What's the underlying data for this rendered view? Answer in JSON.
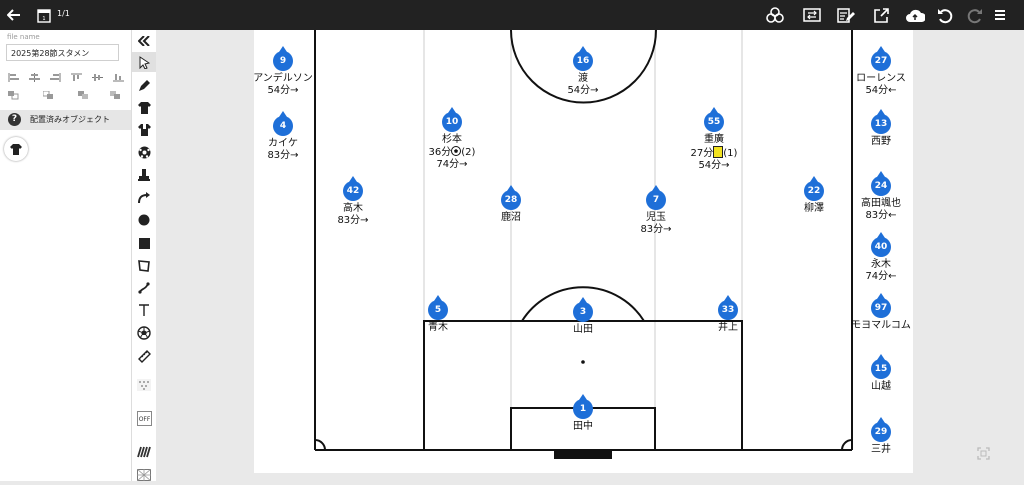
{
  "topbar": {
    "pager": "1/1",
    "icons": [
      "back-arrow-icon",
      "page-icon",
      "team-icon",
      "swap-icon",
      "edit-icon",
      "export-icon",
      "cloud-upload-icon",
      "undo-icon",
      "redo-icon",
      "menu-icon"
    ]
  },
  "file": {
    "label": "file name",
    "value": "2025第28節スタメン"
  },
  "objects": {
    "title": "配置済みオブジェクト"
  },
  "tools": [
    "collapse-icon",
    "pointer-icon",
    "pen-icon",
    "shirt-icon",
    "shirt-alt-icon",
    "ball-icon",
    "cone-icon",
    "curved-arrow-icon",
    "circle-icon",
    "square-icon",
    "polygon-icon",
    "line-icon",
    "text-icon",
    "ball-outline-icon",
    "ruler-icon",
    "formation-icon",
    "off-icon",
    "grass-icon",
    "grid-icon"
  ],
  "colors": {
    "player": "#1e6fd8",
    "yellow_card": "#f2e21f",
    "topbar": "#222222"
  },
  "players": [
    {
      "num": "9",
      "name": "アンデルソン",
      "note": "54分→"
    },
    {
      "num": "4",
      "name": "カイケ",
      "note": "83分→"
    },
    {
      "num": "42",
      "name": "高木",
      "note": "83分→"
    },
    {
      "num": "10",
      "name": "杉本",
      "note_pre": "36分",
      "note_post": "(2)",
      "note2": "74分→"
    },
    {
      "num": "28",
      "name": "鹿沼",
      "note": ""
    },
    {
      "num": "16",
      "name": "渡",
      "note": "54分→"
    },
    {
      "num": "7",
      "name": "児玉",
      "note": "83分→"
    },
    {
      "num": "55",
      "name": "重廣",
      "note_pre": "27分",
      "note_post": "(1)",
      "note2": "54分→"
    },
    {
      "num": "22",
      "name": "柳澤",
      "note": ""
    },
    {
      "num": "5",
      "name": "青木",
      "note": ""
    },
    {
      "num": "3",
      "name": "山田",
      "note": ""
    },
    {
      "num": "33",
      "name": "井上",
      "note": ""
    },
    {
      "num": "1",
      "name": "田中",
      "note": ""
    },
    {
      "num": "27",
      "name": "ローレンス",
      "note": "54分←"
    },
    {
      "num": "13",
      "name": "西野",
      "note": ""
    },
    {
      "num": "24",
      "name": "高田颯也",
      "note": "83分←"
    },
    {
      "num": "40",
      "name": "永木",
      "note": "74分←"
    },
    {
      "num": "97",
      "name": "モヨマルコム",
      "note": ""
    },
    {
      "num": "15",
      "name": "山越",
      "note": ""
    },
    {
      "num": "29",
      "name": "三井",
      "note": ""
    }
  ]
}
